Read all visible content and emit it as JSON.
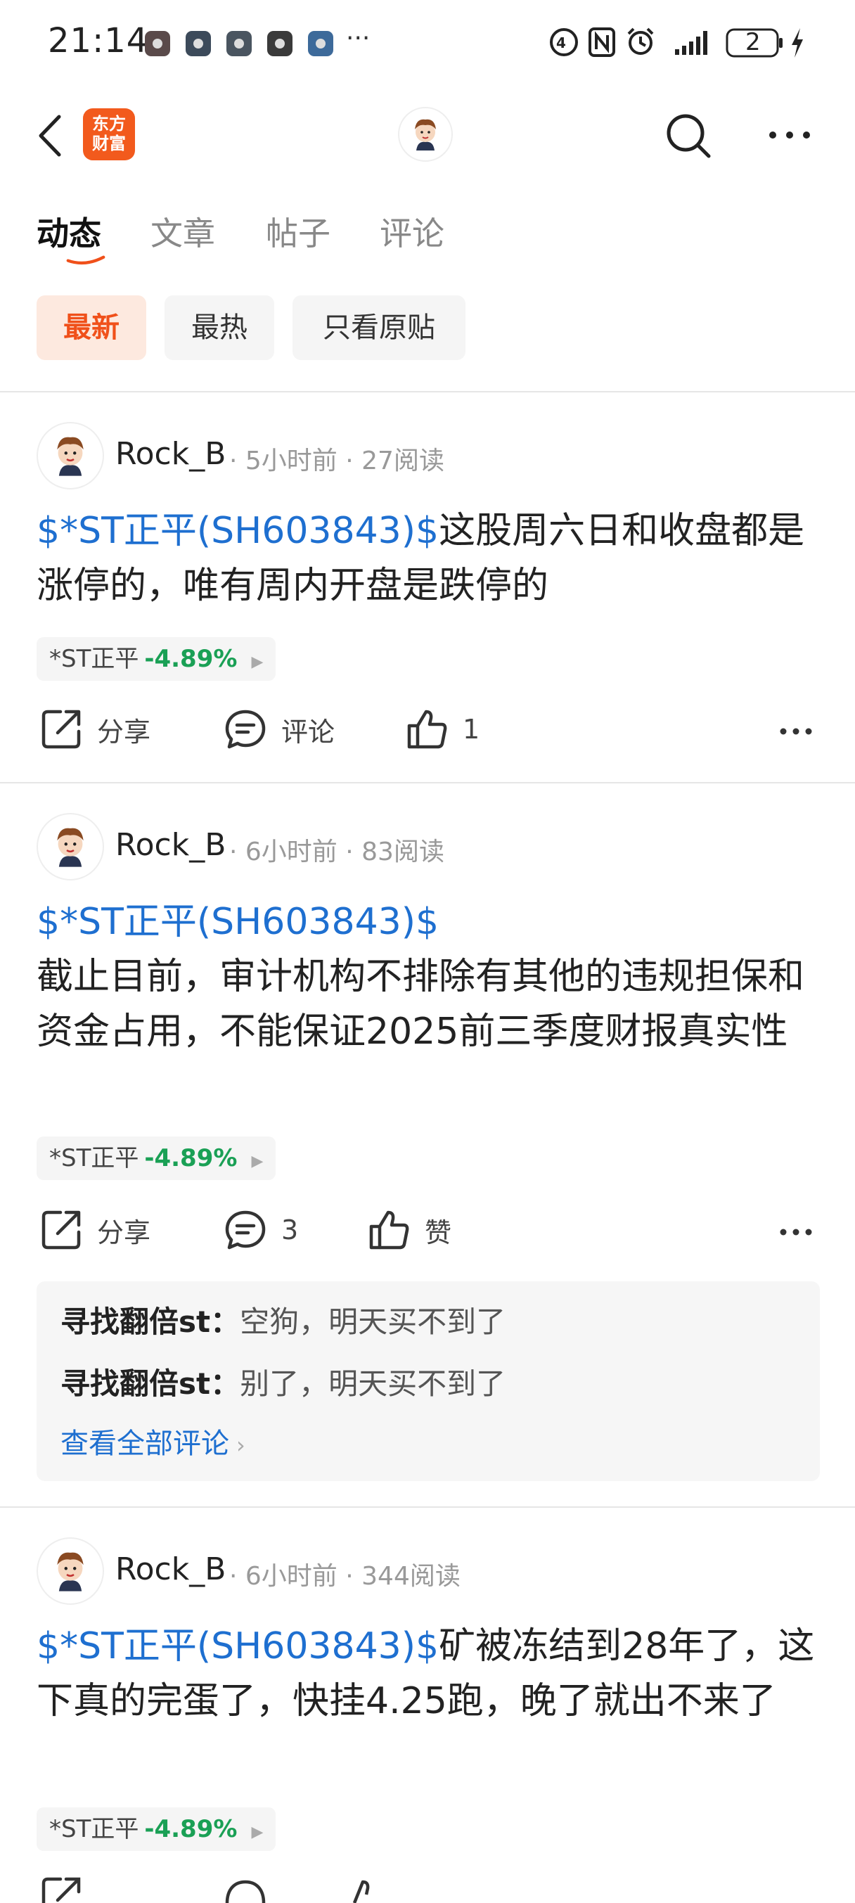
{
  "status_bar": {
    "time": "21:14",
    "more": "···",
    "battery": "2"
  },
  "nav": {
    "logo_line1": "东方",
    "logo_line2": "财富"
  },
  "tabs": [
    {
      "label": "动态"
    },
    {
      "label": "文章"
    },
    {
      "label": "帖子"
    },
    {
      "label": "评论"
    }
  ],
  "filters": [
    {
      "label": "最新"
    },
    {
      "label": "最热"
    },
    {
      "label": "只看原贴"
    }
  ],
  "posts": [
    {
      "author": "Rock_B",
      "time": "5小时前",
      "reads": "27阅读",
      "stock_link": "$*ST正平(SH603843)$",
      "text": "这股周六日和收盘都是涨停的，唯有周内开盘是跌停的",
      "tag_name": "*ST正平",
      "tag_change": "-4.89%",
      "share_label": "分享",
      "comment_label": "评论",
      "like_label": "1"
    },
    {
      "author": "Rock_B",
      "time": "6小时前",
      "reads": "83阅读",
      "stock_link": "$*ST正平(SH603843)$",
      "text": "截止目前，审计机构不排除有其他的违规担保和资金占用，不能保证2025前三季度财报真实性",
      "tag_name": "*ST正平",
      "tag_change": "-4.89%",
      "share_label": "分享",
      "comment_label": "3",
      "like_label": "赞",
      "comments": [
        {
          "user": "寻找翻倍st：",
          "text": "空狗，明天买不到了"
        },
        {
          "user": "寻找翻倍st：",
          "text": "别了，明天买不到了"
        }
      ],
      "view_all": "查看全部评论"
    },
    {
      "author": "Rock_B",
      "time": "6小时前",
      "reads": "344阅读",
      "stock_link": "$*ST正平(SH603843)$",
      "text": "矿被冻结到28年了，这下真的完蛋了，快挂4.25跑，晚了就出不来了",
      "tag_name": "*ST正平",
      "tag_change": "-4.89%"
    }
  ],
  "colors": {
    "accent": "#f0501a",
    "link": "#1e6fd0",
    "down": "#1aa055"
  }
}
